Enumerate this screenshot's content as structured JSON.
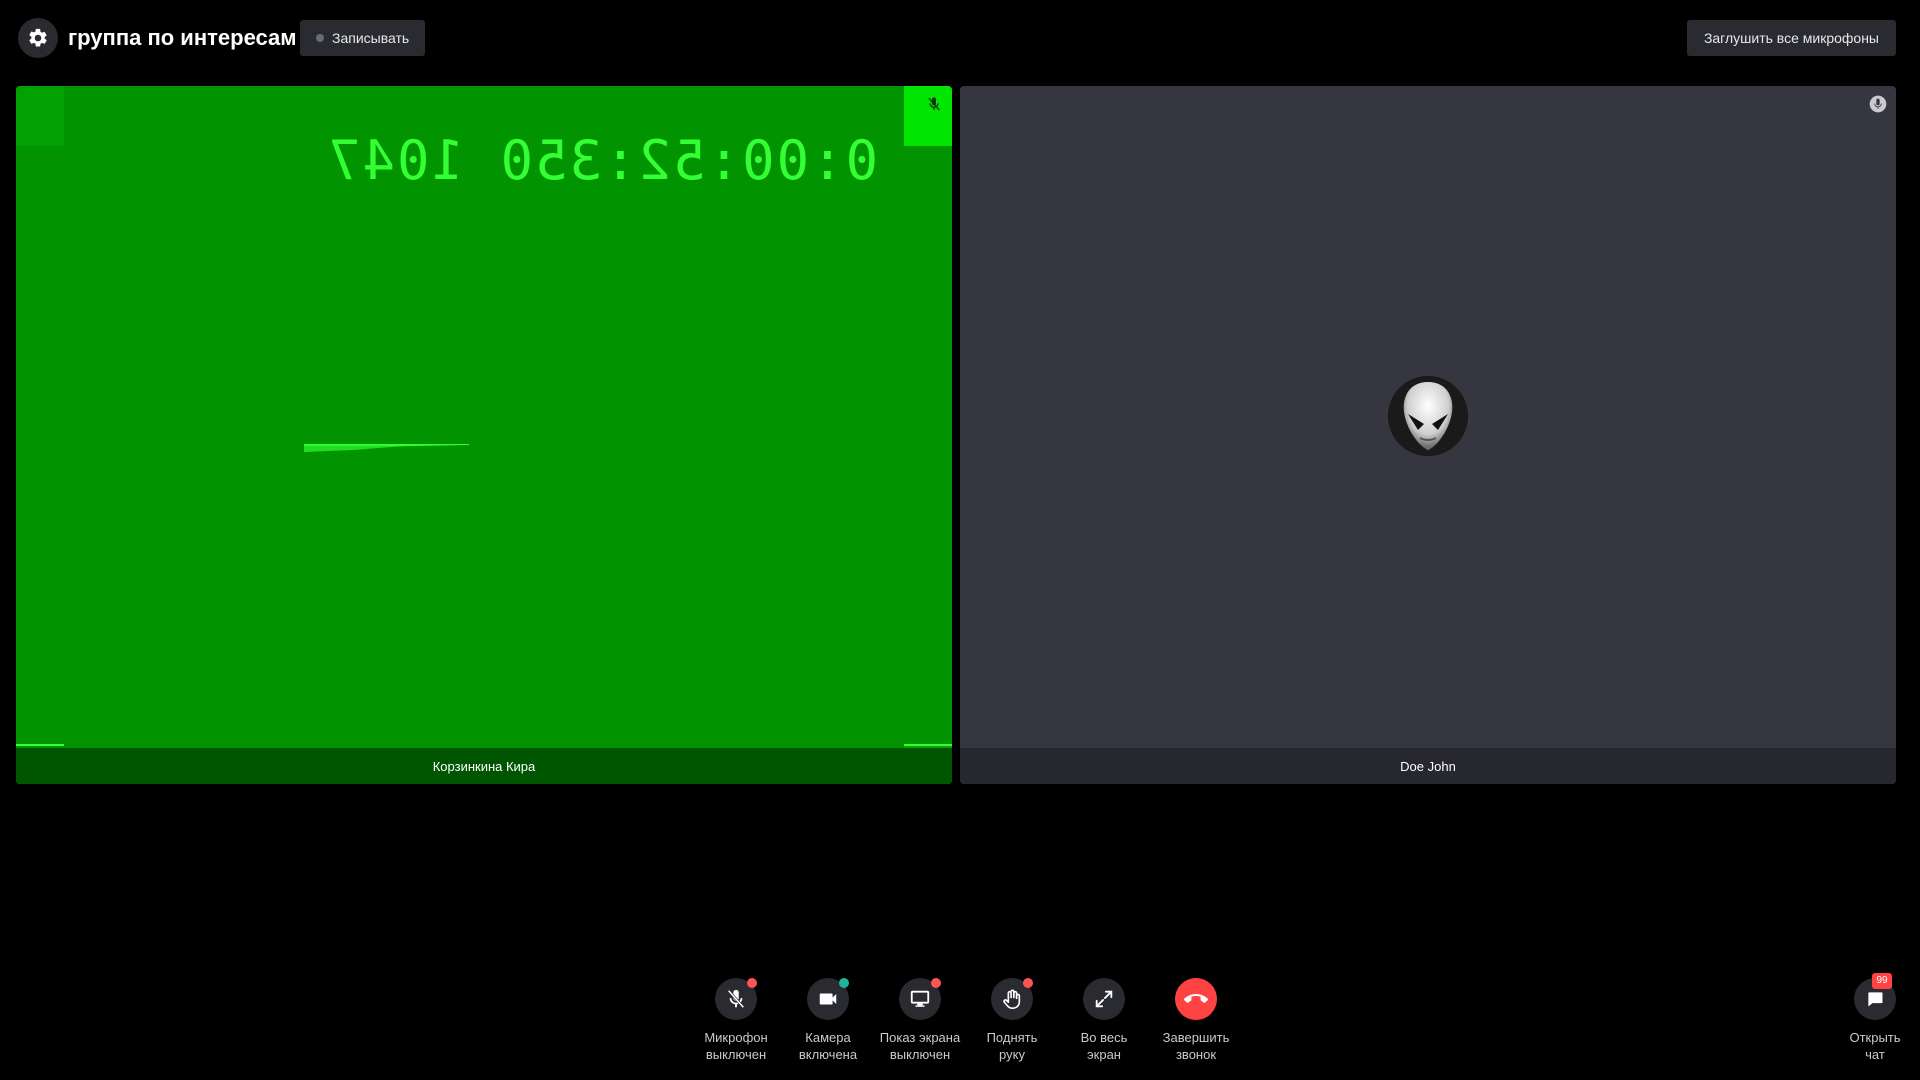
{
  "header": {
    "room_title": "группа по интересам",
    "record_label": "Записывать",
    "mute_all_label": "Заглушить все микрофоны"
  },
  "participants": [
    {
      "name": "Корзинкина Кира",
      "video_timecode": "0:00:52:350 1047",
      "mic_status": "muted",
      "background_color": "#019300"
    },
    {
      "name": "Doe John",
      "mic_status": "on",
      "background_color": "#363641"
    }
  ],
  "controls": [
    {
      "id": "mic",
      "label_line1": "Микрофон",
      "label_line2": "выключен",
      "icon": "mic-off-icon",
      "status": "off"
    },
    {
      "id": "camera",
      "label_line1": "Камера",
      "label_line2": "включена",
      "icon": "camera-icon",
      "status": "on"
    },
    {
      "id": "screen",
      "label_line1": "Показ экрана",
      "label_line2": "выключен",
      "icon": "monitor-icon",
      "status": "off"
    },
    {
      "id": "hand",
      "label_line1": "Поднять",
      "label_line2": "руку",
      "icon": "hand-icon",
      "status": "off"
    },
    {
      "id": "fullscreen",
      "label_line1": "Во весь",
      "label_line2": "экран",
      "icon": "expand-icon"
    },
    {
      "id": "hangup",
      "label_line1": "Завершить",
      "label_line2": "звонок",
      "icon": "phone-hangup-icon"
    }
  ],
  "chat": {
    "label_line1": "Открыть",
    "label_line2": "чат",
    "unread_count": "99"
  },
  "colors": {
    "accent_red": "#ff4242",
    "status_on": "#1db59b",
    "status_off": "#ff5454",
    "button_bg": "#2a2b31"
  }
}
